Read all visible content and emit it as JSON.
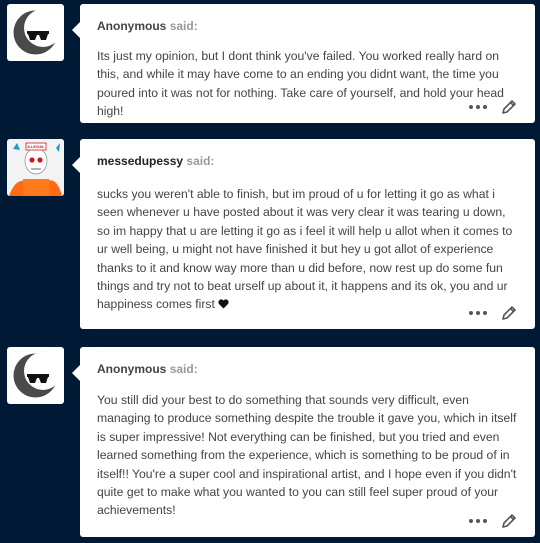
{
  "asks": [
    {
      "asker": "Anonymous",
      "said": "said:",
      "body": "Its just my opinion, but I dont think you've failed. You worked really hard on this, and while it may have come to an ending you didnt want, the time you poured into it was not for nothing. Take care of yourself, and hold your head high!",
      "avatar": "anonymous-sunglasses-avatar"
    },
    {
      "asker": "messedupessy",
      "said": "said:",
      "body": "sucks you weren't able to finish, but im proud of u for letting it go as what i seen whenever u have posted about it was very clear it was tearing u down, so im happy that u are letting it go as i feel it will help u allot when it comes to ur well being, u might not have finished it but hey u got allot of experience thanks to it and know way more than u did before, now rest up do some fun things and try not to beat urself up about it, it happens and its ok, you and ur happiness comes first",
      "avatar": "skeleton-avatar",
      "avatar_badge": "ILLEGAL"
    },
    {
      "asker": "Anonymous",
      "said": "said:",
      "body": "You still did your best to do something that sounds very difficult, even managing to produce something despite the trouble it gave you, which in itself is super impressive! Not everything can be finished, but you tried and even learned something from the experience, which is something to be proud of in itself!! You're a super cool and inspirational artist, and I hope even if you didn't quite get to make what you wanted to you can still feel super proud of your achievements!",
      "avatar": "anonymous-sunglasses-avatar"
    }
  ],
  "colors": {
    "background": "#001935",
    "card": "#ffffff",
    "text": "#444444",
    "muted": "#999999"
  }
}
